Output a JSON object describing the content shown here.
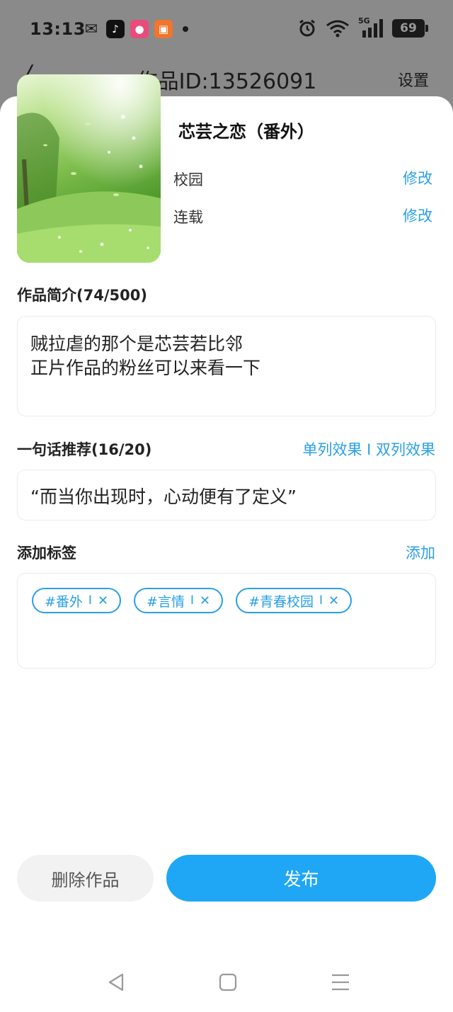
{
  "status_bar": {
    "time": "13:13",
    "network": "5G",
    "battery": "69"
  },
  "background_page": {
    "title": "作品ID:13526091",
    "settings": "设置"
  },
  "work": {
    "title": "芯芸之恋（番外）",
    "category": "校园",
    "category_edit": "修改",
    "status": "连载",
    "status_edit": "修改"
  },
  "intro": {
    "label": "作品简介(74/500)",
    "text": "贼拉虐的那个是芯芸若比邻\n正片作品的粉丝可以来看一下"
  },
  "recommend": {
    "label": "一句话推荐(16/20)",
    "view_options": "单列效果 I 双列效果",
    "text": "“而当你出现时，心动便有了定义”"
  },
  "tags_section": {
    "label": "添加标签",
    "add": "添加",
    "tags": [
      {
        "text": "#番外",
        "sep": "I",
        "remove": "✕"
      },
      {
        "text": "#言情",
        "sep": "I",
        "remove": "✕"
      },
      {
        "text": "#青春校园",
        "sep": "I",
        "remove": "✕"
      }
    ]
  },
  "actions": {
    "delete": "删除作品",
    "publish": "发布"
  },
  "colors": {
    "accent": "#29a0e8",
    "publish_bg": "#1fa7f5",
    "dim_overlay": "#8a8a8a"
  }
}
